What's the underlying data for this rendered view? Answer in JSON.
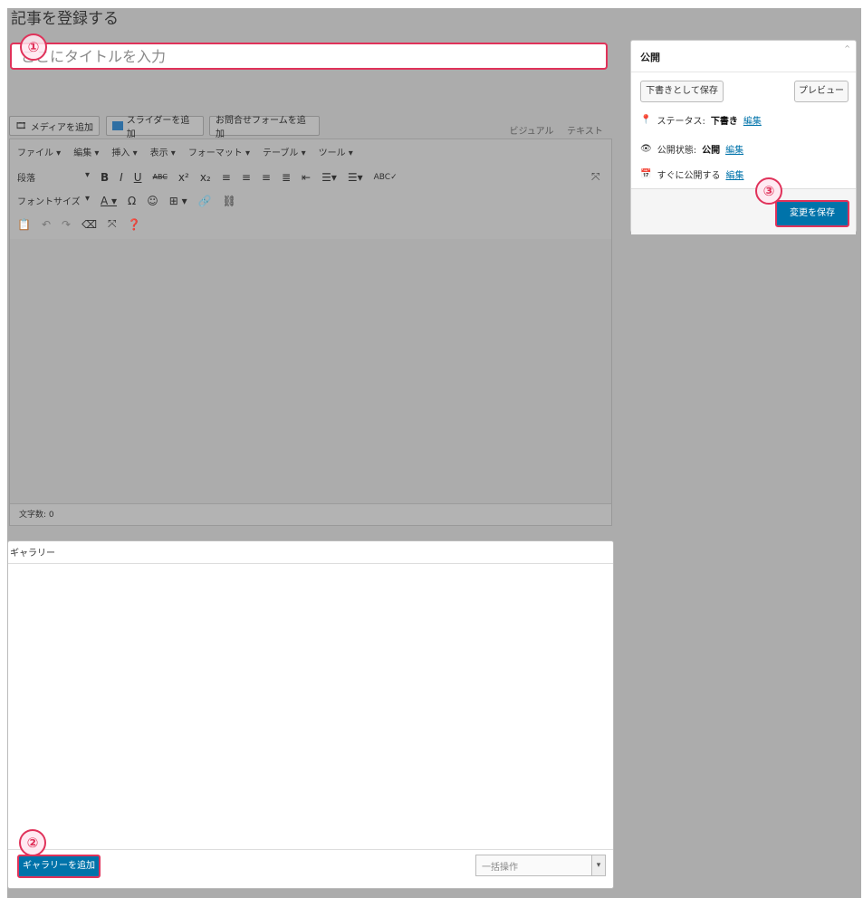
{
  "page": {
    "title": "記事を登録する"
  },
  "title_input": {
    "placeholder": "ここにタイトルを入力"
  },
  "markers": {
    "one": "①",
    "two": "②",
    "three": "③"
  },
  "media_buttons": {
    "add_media": "メディアを追加",
    "add_slider": "スライダーを追加",
    "add_form": "お問合せフォームを追加"
  },
  "editor_tabs": {
    "visual": "ビジュアル",
    "text": "テキスト"
  },
  "menubar": [
    "ファイル ▾",
    "編集 ▾",
    "挿入 ▾",
    "表示 ▾",
    "フォーマット ▾",
    "テーブル ▾",
    "ツール ▾"
  ],
  "toolbar": {
    "paragraph": "段落",
    "font_size": "フォントサイズ",
    "row1_icons": [
      "bold-icon",
      "italic-icon",
      "underline-icon",
      "strikethrough-icon",
      "superscript-icon",
      "subscript-icon",
      "align-left-icon",
      "align-center-icon",
      "align-right-icon",
      "justify-icon",
      "outdent-icon",
      "bullet-list-icon",
      "numbered-list-icon",
      "spellcheck-icon"
    ],
    "fullscreen_icon": "fullscreen-icon",
    "row2_icons": [
      "text-color-icon",
      "omega-icon",
      "emoji-icon",
      "table-icon",
      "link-icon",
      "unlink-icon"
    ],
    "row3_icons": [
      "paste-icon",
      "undo-icon",
      "redo-icon",
      "eraser-icon",
      "fullscreen-icon",
      "help-icon"
    ]
  },
  "status": {
    "word_count": "文字数: 0"
  },
  "gallery": {
    "title": "ギャラリー",
    "add_button": "ギャラリーを追加",
    "bulk_select": "一括操作"
  },
  "publish": {
    "title": "公開",
    "save_draft": "下書きとして保存",
    "preview": "プレビュー",
    "status_label": "ステータス:",
    "status_value": "下書き",
    "visibility_label": "公開状態:",
    "visibility_value": "公開",
    "schedule_label": "すぐに公開する",
    "edit_link": "編集",
    "save_button": "変更を保存"
  },
  "colors": {
    "accent": "#0073aa",
    "highlight": "#e0325a"
  }
}
